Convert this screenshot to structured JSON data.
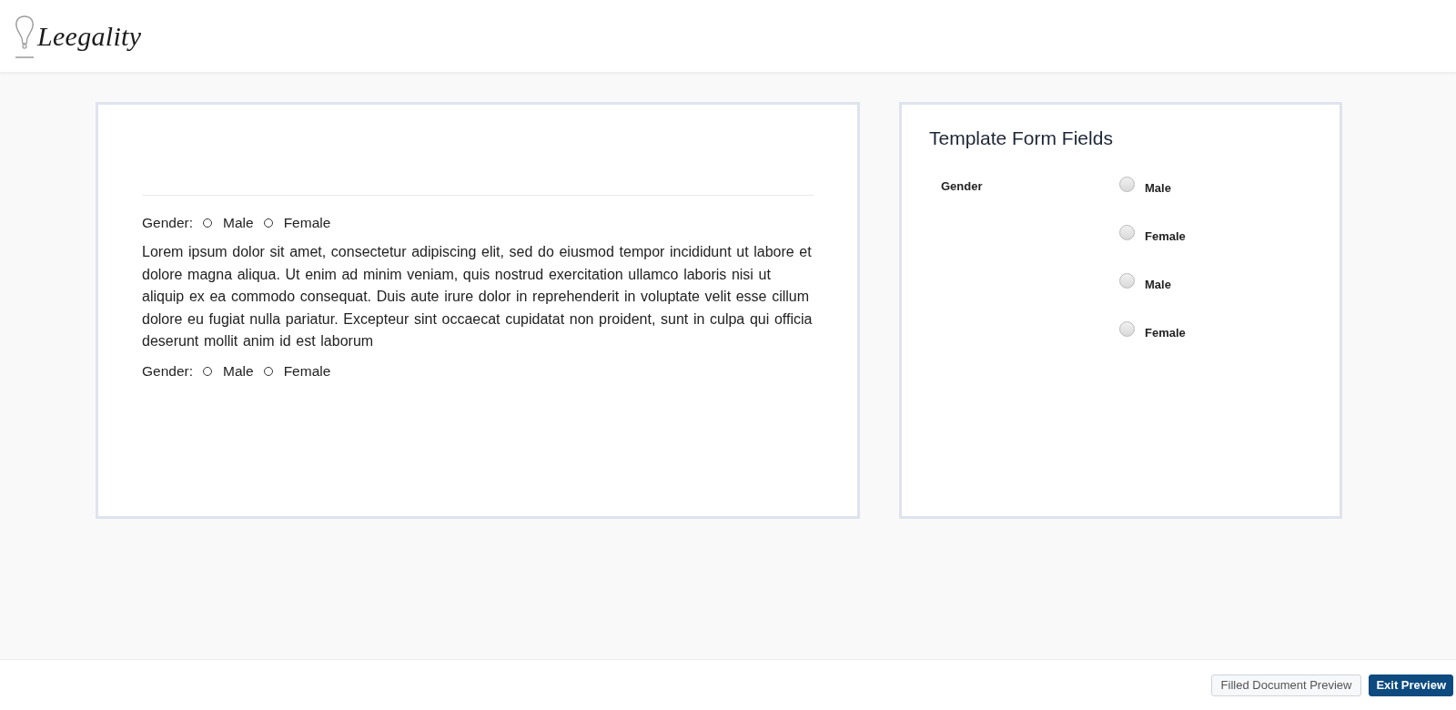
{
  "header": {
    "logo_text": "Leegality"
  },
  "document": {
    "blocks": [
      {
        "kind": "radio_group",
        "label": "Gender:",
        "options": [
          {
            "label": "Male",
            "selected": false
          },
          {
            "label": "Female",
            "selected": false
          }
        ]
      },
      {
        "kind": "paragraph",
        "text": "Lorem ipsum dolor sit amet, consectetur adipiscing elit, sed do eiusmod tempor incididunt ut labore et dolore magna aliqua. Ut enim ad minim veniam, quis nostrud exercitation ullamco laboris nisi ut aliquip ex ea commodo consequat. Duis aute irure dolor in reprehenderit in voluptate velit esse cillum dolore eu fugiat nulla pariatur. Excepteur sint occaecat cupidatat non proident, sunt in culpa qui officia deserunt mollit anim id est laborum"
      },
      {
        "kind": "radio_group",
        "label": "Gender:",
        "options": [
          {
            "label": "Male",
            "selected": false
          },
          {
            "label": "Female",
            "selected": false
          }
        ]
      }
    ]
  },
  "form_panel": {
    "title": "Template Form Fields",
    "fields": [
      {
        "label": "Gender",
        "options": [
          {
            "label": "Male",
            "selected": false
          },
          {
            "label": "Female",
            "selected": false
          },
          {
            "label": "Male",
            "selected": false
          },
          {
            "label": "Female",
            "selected": false
          }
        ]
      }
    ]
  },
  "footer": {
    "buttons": [
      {
        "label": "Filled Document Preview",
        "kind": "secondary"
      },
      {
        "label": "Exit Preview",
        "kind": "primary"
      }
    ]
  }
}
